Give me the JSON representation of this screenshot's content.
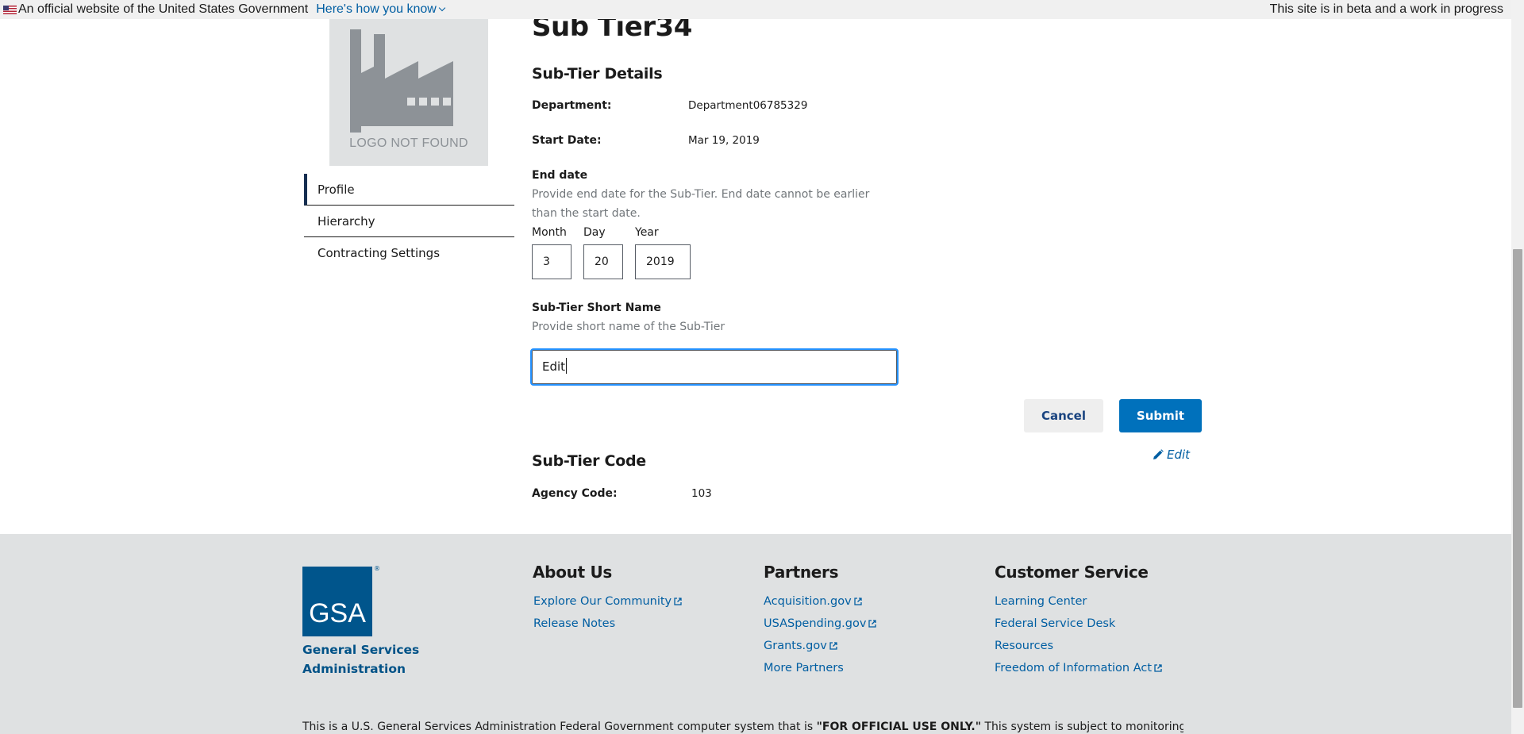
{
  "banner": {
    "official_text": "An official website of the United States Government",
    "how_you_know": "Here's how you know",
    "beta_text": "This site is in beta and a work in progress"
  },
  "logo": {
    "text": "LOGO NOT FOUND"
  },
  "side_nav": {
    "items": [
      {
        "label": "Profile",
        "active": true
      },
      {
        "label": "Hierarchy",
        "active": false
      },
      {
        "label": "Contracting Settings",
        "active": false
      }
    ]
  },
  "page": {
    "title": "Sub Tier34"
  },
  "details": {
    "heading": "Sub-Tier Details",
    "department_label": "Department:",
    "department_value": "Department06785329",
    "start_date_label": "Start Date:",
    "start_date_value": "Mar 19, 2019"
  },
  "end_date": {
    "label": "End date",
    "hint": "Provide end date for the Sub-Tier. End date cannot be earlier than the start date.",
    "month_label": "Month",
    "day_label": "Day",
    "year_label": "Year",
    "month_value": "3",
    "day_value": "20",
    "year_value": "2019"
  },
  "short_name": {
    "label": "Sub-Tier Short Name",
    "hint": "Provide short name of the Sub-Tier",
    "value": "Edit"
  },
  "actions": {
    "cancel": "Cancel",
    "submit": "Submit"
  },
  "code": {
    "heading": "Sub-Tier Code",
    "edit_link": "Edit",
    "agency_code_label": "Agency Code:",
    "agency_code_value": "103"
  },
  "footer": {
    "gsa_letters": "GSA",
    "gsa_registered": "®",
    "gsa_name": "General Services Administration",
    "about": {
      "heading": "About Us",
      "links": [
        "Explore Our Community",
        "Release Notes"
      ]
    },
    "partners": {
      "heading": "Partners",
      "links": [
        "Acquisition.gov",
        "USASpending.gov",
        "Grants.gov",
        "More Partners"
      ]
    },
    "customer_service": {
      "heading": "Customer Service",
      "links": [
        "Learning Center",
        "Federal Service Desk",
        "Resources",
        "Freedom of Information Act"
      ]
    },
    "disclaimer_start": "This is a U.S. General Services Administration Federal Government computer system that is ",
    "disclaimer_bold": "\"FOR OFFICIAL USE ONLY.\"",
    "disclaimer_end": " This system is subject to monitoring. Individuals"
  },
  "colors": {
    "primary_button": "#0071bc",
    "link": "#005ea2",
    "footer_bg": "#dfe1e2",
    "gsa_blue": "#00558c",
    "focus_outline": "#2491ff"
  }
}
